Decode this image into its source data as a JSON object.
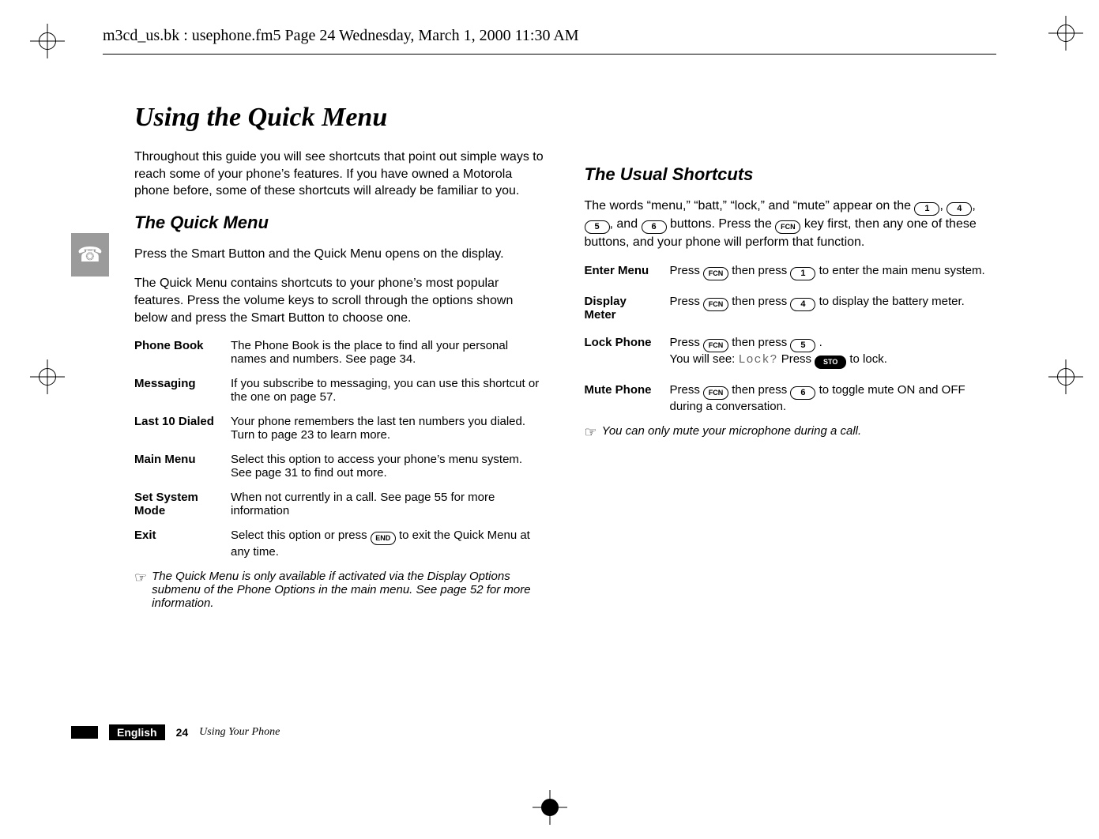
{
  "header": {
    "runner": "m3cd_us.bk : usephone.fm5  Page 24  Wednesday, March 1, 2000  11:30 AM"
  },
  "title": "Using the Quick Menu",
  "intro": "Throughout this guide you will see shortcuts that point out simple ways to reach some of your phone’s features. If you have owned a Motorola phone before, some of these shortcuts will already be familiar to you.",
  "quick_menu": {
    "heading": "The Quick Menu",
    "p1": "Press the Smart Button and the Quick Menu opens on the display.",
    "p2": "The Quick Menu contains shortcuts to your phone’s most popular features. Press the volume keys to scroll through the options shown below and press the Smart Button to choose one.",
    "items": [
      {
        "label": "Phone Book",
        "desc": "The Phone Book is the place to find all your personal names and numbers. See page 34."
      },
      {
        "label": "Messaging",
        "desc": "If you subscribe to messaging, you can use this shortcut or the one on page 57."
      },
      {
        "label": "Last 10 Dialed",
        "desc": "Your phone remembers the last ten numbers you dialed. Turn to page 23 to learn more."
      },
      {
        "label": "Main Menu",
        "desc": "Select this option to access your phone’s menu system. See page 31 to find out more."
      },
      {
        "label": "Set System Mode",
        "desc": "When not currently in a call. See page 55 for more information"
      },
      {
        "label": "Exit",
        "desc_pre": "Select this option or press ",
        "key": "END",
        "desc_post": " to exit the Quick Menu at any time."
      }
    ],
    "note": "The Quick Menu is only available if activated via the Display Options submenu of the Phone Options in the main menu. See page 52 for more information."
  },
  "shortcuts": {
    "heading": "The Usual Shortcuts",
    "intro_pre": "The words “menu,” “batt,” “lock,” and “mute” appear on the ",
    "intro_keys": [
      "1",
      "4",
      "5",
      "6"
    ],
    "intro_mid": " buttons. Press the ",
    "intro_fcn": "FCN",
    "intro_post": " key first, then any one of these buttons, and your phone will perform that function.",
    "rows": [
      {
        "label": "Enter Menu",
        "pre": "Press ",
        "k1": "FCN",
        "mid": " then press ",
        "k2": "1",
        "post": " to enter the main menu system."
      },
      {
        "label": "Display Meter",
        "pre": "Press ",
        "k1": "FCN",
        "mid": " then press ",
        "k2": "4",
        "post": " to display the battery meter."
      },
      {
        "label": "Lock Phone",
        "pre": "Press ",
        "k1": "FCN",
        "mid": " then press ",
        "k2": "5",
        "post1": ".",
        "line2_pre": "You will see: ",
        "line2_lcd": "Lock?",
        "line2_mid": " Press ",
        "line2_key": "STO",
        "line2_post": " to lock."
      },
      {
        "label": "Mute Phone",
        "pre": "Press ",
        "k1": "FCN",
        "mid": " then press ",
        "k2": "6",
        "post": " to toggle mute ON and OFF during a conversation."
      }
    ],
    "note": "You can only mute your microphone during a call."
  },
  "footer": {
    "language": "English",
    "page_number": "24",
    "section": "Using Your Phone"
  },
  "icons": {
    "note_hand": "☞",
    "side_tab": "☎"
  },
  "words": {
    "and": ", and "
  }
}
